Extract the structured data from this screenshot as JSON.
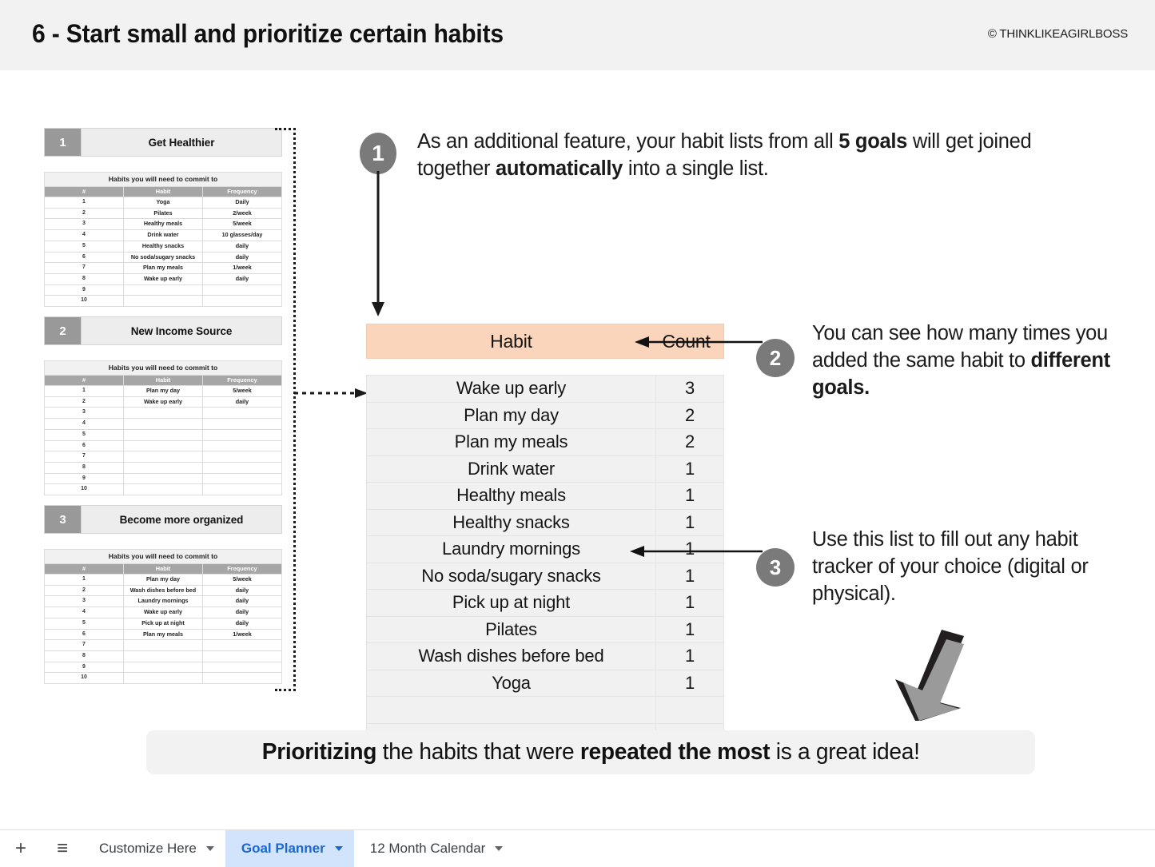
{
  "header": {
    "title": "6 - Start small and prioritize certain habits",
    "copyright": "© THINKLIKEAGIRLBOSS"
  },
  "goal_cards": [
    {
      "number": "1",
      "name": "Get Healthier",
      "caption": "Habits you will need to commit to",
      "columns": [
        "#",
        "Habit",
        "Frequency"
      ],
      "rows": [
        {
          "idx": "1",
          "habit": "Yoga",
          "frequency": "Daily"
        },
        {
          "idx": "2",
          "habit": "Pilates",
          "frequency": "2/week"
        },
        {
          "idx": "3",
          "habit": "Healthy meals",
          "frequency": "5/week"
        },
        {
          "idx": "4",
          "habit": "Drink water",
          "frequency": "10 glasses/day"
        },
        {
          "idx": "5",
          "habit": "Healthy snacks",
          "frequency": "daily"
        },
        {
          "idx": "6",
          "habit": "No soda/sugary snacks",
          "frequency": "daily"
        },
        {
          "idx": "7",
          "habit": "Plan my meals",
          "frequency": "1/week"
        },
        {
          "idx": "8",
          "habit": "Wake up early",
          "frequency": "daily"
        },
        {
          "idx": "9",
          "habit": "",
          "frequency": ""
        },
        {
          "idx": "10",
          "habit": "",
          "frequency": ""
        }
      ]
    },
    {
      "number": "2",
      "name": "New Income Source",
      "caption": "Habits you will need to commit to",
      "columns": [
        "#",
        "Habit",
        "Frequency"
      ],
      "rows": [
        {
          "idx": "1",
          "habit": "Plan my day",
          "frequency": "5/week"
        },
        {
          "idx": "2",
          "habit": "Wake up early",
          "frequency": "daily"
        },
        {
          "idx": "3",
          "habit": "",
          "frequency": ""
        },
        {
          "idx": "4",
          "habit": "",
          "frequency": ""
        },
        {
          "idx": "5",
          "habit": "",
          "frequency": ""
        },
        {
          "idx": "6",
          "habit": "",
          "frequency": ""
        },
        {
          "idx": "7",
          "habit": "",
          "frequency": ""
        },
        {
          "idx": "8",
          "habit": "",
          "frequency": ""
        },
        {
          "idx": "9",
          "habit": "",
          "frequency": ""
        },
        {
          "idx": "10",
          "habit": "",
          "frequency": ""
        }
      ]
    },
    {
      "number": "3",
      "name": "Become more organized",
      "caption": "Habits you will need to commit to",
      "columns": [
        "#",
        "Habit",
        "Frequency"
      ],
      "rows": [
        {
          "idx": "1",
          "habit": "Plan my day",
          "frequency": "5/week"
        },
        {
          "idx": "2",
          "habit": "Wash dishes before bed",
          "frequency": "daily"
        },
        {
          "idx": "3",
          "habit": "Laundry mornings",
          "frequency": "daily"
        },
        {
          "idx": "4",
          "habit": "Wake up early",
          "frequency": "daily"
        },
        {
          "idx": "5",
          "habit": "Pick up at night",
          "frequency": "daily"
        },
        {
          "idx": "6",
          "habit": "Plan my meals",
          "frequency": "1/week"
        },
        {
          "idx": "7",
          "habit": "",
          "frequency": ""
        },
        {
          "idx": "8",
          "habit": "",
          "frequency": ""
        },
        {
          "idx": "9",
          "habit": "",
          "frequency": ""
        },
        {
          "idx": "10",
          "habit": "",
          "frequency": ""
        }
      ]
    }
  ],
  "count_table": {
    "columns": [
      "Habit",
      "Count"
    ],
    "header_bg": "#fbd5bb",
    "rows": [
      {
        "habit": "Wake up early",
        "count": "3"
      },
      {
        "habit": "Plan my day",
        "count": "2"
      },
      {
        "habit": "Plan my meals",
        "count": "2"
      },
      {
        "habit": "Drink water",
        "count": "1"
      },
      {
        "habit": "Healthy meals",
        "count": "1"
      },
      {
        "habit": "Healthy snacks",
        "count": "1"
      },
      {
        "habit": "Laundry mornings",
        "count": "1"
      },
      {
        "habit": "No soda/sugary snacks",
        "count": "1"
      },
      {
        "habit": "Pick up at night",
        "count": "1"
      },
      {
        "habit": "Pilates",
        "count": "1"
      },
      {
        "habit": "Wash dishes before bed",
        "count": "1"
      },
      {
        "habit": "Yoga",
        "count": "1"
      },
      {
        "habit": "",
        "count": ""
      },
      {
        "habit": "",
        "count": ""
      }
    ]
  },
  "callouts": [
    {
      "badge": "1",
      "segments": [
        {
          "text": "As an additional feature, your habit lists from all ",
          "bold": false
        },
        {
          "text": "5 goals",
          "bold": true
        },
        {
          "text": " will get joined together ",
          "bold": false
        },
        {
          "text": "automatically",
          "bold": true
        },
        {
          "text": " into a single list.",
          "bold": false
        }
      ]
    },
    {
      "badge": "2",
      "segments": [
        {
          "text": "You can see how many times you added the same habit to ",
          "bold": false
        },
        {
          "text": "different goals.",
          "bold": true
        }
      ]
    },
    {
      "badge": "3",
      "segments": [
        {
          "text": "Use this list to fill out any habit tracker of your choice (digital or physical).",
          "bold": false
        }
      ]
    }
  ],
  "banner": {
    "segments": [
      {
        "text": "Prioritizing",
        "bold": true
      },
      {
        "text": " the habits that were ",
        "bold": false
      },
      {
        "text": "repeated the most",
        "bold": true
      },
      {
        "text": " is a great idea!",
        "bold": false
      }
    ]
  },
  "tabbar": {
    "add_label": "+",
    "menu_label": "≡",
    "tabs": [
      {
        "label": "Customize Here",
        "active": false
      },
      {
        "label": "Goal Planner",
        "active": true
      },
      {
        "label": "12 Month Calendar",
        "active": false
      }
    ]
  }
}
